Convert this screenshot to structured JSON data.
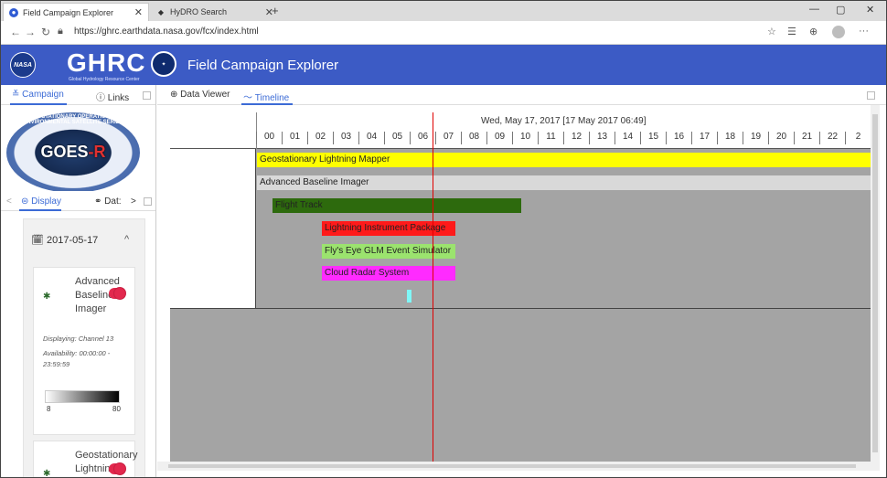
{
  "browser": {
    "tabs": [
      {
        "title": "Field Campaign Explorer"
      },
      {
        "title": "HyDRO Search"
      }
    ],
    "url": "https://ghrc.earthdata.nasa.gov/fcx/index.html",
    "icons": {
      "back": "back-arrow-icon",
      "forward": "forward-arrow-icon",
      "refresh": "refresh-icon",
      "lock": "lock-icon"
    }
  },
  "header": {
    "nasa_label": "NASA",
    "ghrc_label": "GHRC",
    "ghrc_sub": "Global Hydrology Resource Center",
    "title": "Field Campaign Explorer",
    "bg_color": "#3c5bc5"
  },
  "left": {
    "tabs": [
      "Campaign",
      "Links"
    ],
    "logo": {
      "ring": "GEOSTATIONARY OPERATIONAL ENVIRONMENTAL SATELLITE SERIES",
      "main": "GOES",
      "r": "-R"
    },
    "subtabs": [
      "Display",
      "Dat:"
    ],
    "date": "2017-05-17",
    "cards": [
      {
        "name_lines": [
          "Advanced",
          "Baseline",
          "Imager"
        ],
        "displaying": "Displaying: Channel 13",
        "availability_1": "Availability: 00:00:00 -",
        "availability_2": "23:59:59",
        "cb_min": "8",
        "cb_max": "80"
      },
      {
        "name_lines": [
          "Geostationary",
          "Lightning"
        ]
      }
    ]
  },
  "right": {
    "tabs": [
      "Data Viewer",
      "Timeline"
    ]
  },
  "timeline": {
    "date_label": "Wed, May 17, 2017 [17 May 2017 06:49]",
    "hours": [
      "00",
      "01",
      "02",
      "03",
      "04",
      "05",
      "06",
      "07",
      "08",
      "09",
      "10",
      "11",
      "12",
      "13",
      "14",
      "15",
      "16",
      "17",
      "18",
      "19",
      "20",
      "21",
      "22",
      "2"
    ],
    "bars": [
      {
        "label": "Geostationary Lightning Mapper",
        "color": "#ffff00"
      },
      {
        "label": "Advanced Baseline Imager",
        "color": "#d9d9d9"
      },
      {
        "label": "Flight Track",
        "color": "#2d6a0d"
      },
      {
        "label": "Lightning Instrument Package",
        "color": "#ff1a1a"
      },
      {
        "label": "Fly's Eye GLM Event Simulator",
        "color": "#9be36e"
      },
      {
        "label": "Cloud Radar System",
        "color": "#ff2bff"
      },
      {
        "label": "",
        "color": "#7ff7f7"
      }
    ],
    "now_line_color": "#e00000"
  }
}
